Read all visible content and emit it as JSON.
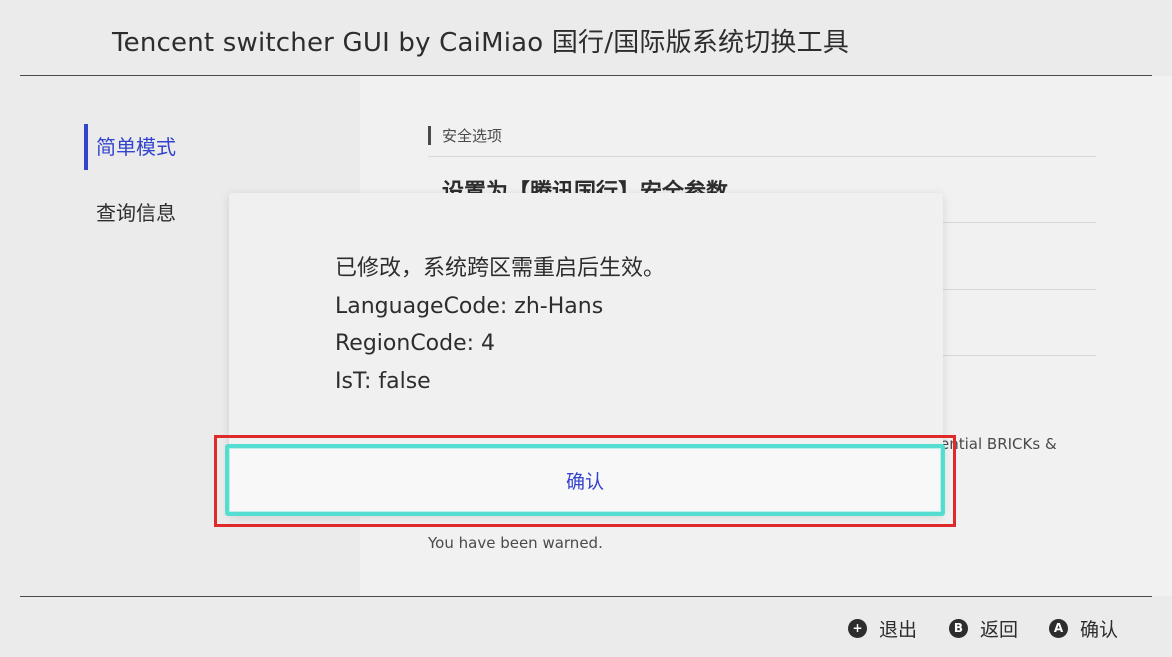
{
  "header": {
    "title": "Tencent switcher GUI by CaiMiao   国行/国际版系统切换工具"
  },
  "sidebar": {
    "items": [
      {
        "label": "简单模式",
        "active": true
      },
      {
        "label": "查询信息",
        "active": false
      }
    ]
  },
  "content": {
    "section_title": "安全选项",
    "option_1": "设置为【腾讯国行】安全参数",
    "partial_text": "ential BRICKs &",
    "warning": "You have been warned."
  },
  "dialog": {
    "lines": [
      "已修改，系统跨区需重启后生效。",
      "LanguageCode: zh-Hans",
      "RegionCode: 4",
      "IsT: false"
    ],
    "confirm_label": "确认"
  },
  "footer": {
    "buttons": [
      {
        "glyph": "+",
        "label": "退出"
      },
      {
        "glyph": "B",
        "label": "返回"
      },
      {
        "glyph": "A",
        "label": "确认"
      }
    ]
  },
  "colors": {
    "accent": "#3344cc",
    "focus_border": "#54ddd0",
    "highlight": "#e02a2a"
  }
}
